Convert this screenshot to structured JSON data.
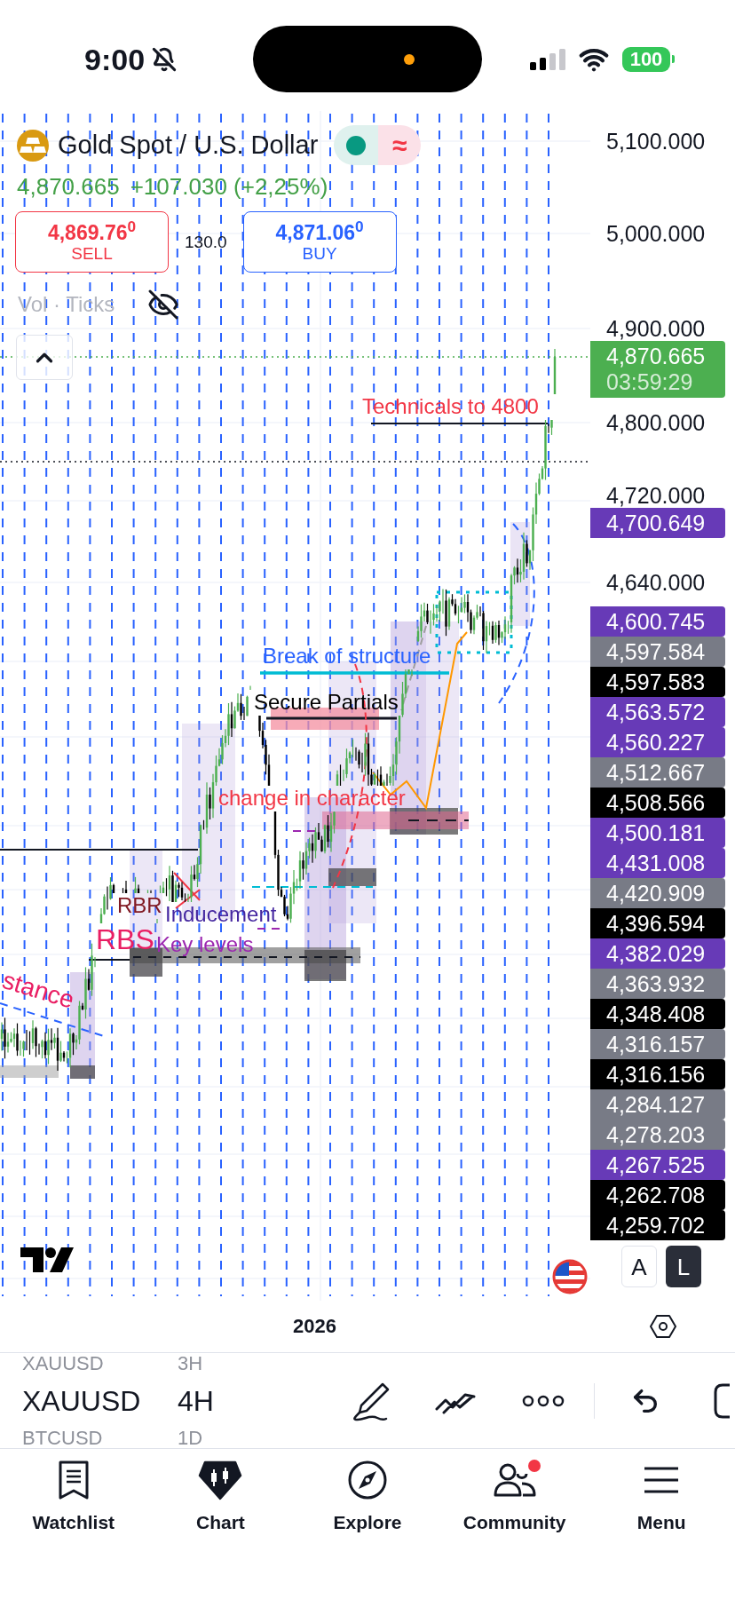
{
  "status_bar": {
    "time": "9:00",
    "battery": "100"
  },
  "header": {
    "title": "Gold Spot / U.S. Dollar",
    "delay_symbol": "≈",
    "price": "4,870.665",
    "change": "+107.030 (+2,25%)"
  },
  "trade": {
    "sell": {
      "price": "4,869.76$^{0}$",
      "label": "SELL"
    },
    "spread": "130.0",
    "buy": {
      "price": "4,871.06$^{0}$",
      "label": "BUY"
    }
  },
  "indicator": {
    "label": "Vol · Ticks",
    "visible": false
  },
  "annotations": [
    {
      "text": "Technicals to 4800",
      "color": "#f23645"
    },
    {
      "text": "Break of structure",
      "color": "#2962ff"
    },
    {
      "text": "Secure Partials",
      "color": "#000000"
    },
    {
      "text": "change in character",
      "color": "#f23645"
    },
    {
      "text": "RBR",
      "color": "#801922"
    },
    {
      "text": "Inducement",
      "color": "#4527a0"
    },
    {
      "text": "RBS",
      "color": "#e91e63"
    },
    {
      "text": "Key levels",
      "color": "#9c27b0"
    },
    {
      "text": "stance",
      "color": "#e91e63"
    }
  ],
  "price_axis": {
    "ticks": [
      "5,100.000",
      "5,000.000",
      "4,900.000",
      "4,800.000",
      "4,720.000",
      "4,640.000"
    ],
    "last_price": {
      "price": "4,870.665",
      "countdown": "03:59:29"
    },
    "labels": [
      {
        "value": "4,700.649",
        "color": "#673ab7"
      },
      {
        "value": "4,600.745",
        "color": "#673ab7"
      },
      {
        "value": "4,597.584",
        "color": "#787b86"
      },
      {
        "value": "4,597.583",
        "color": "#000000"
      },
      {
        "value": "4,563.572",
        "color": "#673ab7"
      },
      {
        "value": "4,560.227",
        "color": "#673ab7"
      },
      {
        "value": "4,512.667",
        "color": "#787b86"
      },
      {
        "value": "4,508.566",
        "color": "#000000"
      },
      {
        "value": "4,500.181",
        "color": "#673ab7"
      },
      {
        "value": "4,431.008",
        "color": "#673ab7"
      },
      {
        "value": "4,420.909",
        "color": "#787b86"
      },
      {
        "value": "4,396.594",
        "color": "#000000"
      },
      {
        "value": "4,382.029",
        "color": "#673ab7"
      },
      {
        "value": "4,363.932",
        "color": "#787b86"
      },
      {
        "value": "4,348.408",
        "color": "#000000"
      },
      {
        "value": "4,316.157",
        "color": "#787b86"
      },
      {
        "value": "4,316.156",
        "color": "#000000"
      },
      {
        "value": "4,284.127",
        "color": "#787b86"
      },
      {
        "value": "4,278.203",
        "color": "#787b86"
      },
      {
        "value": "4,267.525",
        "color": "#673ab7"
      },
      {
        "value": "4,262.708",
        "color": "#000000"
      },
      {
        "value": "4,259.702",
        "color": "#000000"
      }
    ]
  },
  "scale_buttons": [
    {
      "label": "A",
      "selected": false
    },
    {
      "label": "L",
      "selected": true
    }
  ],
  "time_axis": {
    "year": "2026"
  },
  "toolbar": {
    "symbols": [
      {
        "text": "XAUUSD",
        "selected": false
      },
      {
        "text": "XAUUSD",
        "selected": true
      },
      {
        "text": "BTCUSD",
        "selected": false
      }
    ],
    "intervals": [
      {
        "text": "3H",
        "selected": false
      },
      {
        "text": "4H",
        "selected": true
      },
      {
        "text": "1D",
        "selected": false
      }
    ]
  },
  "tab_bar": [
    {
      "label": "Watchlist",
      "selected": false,
      "notification": false
    },
    {
      "label": "Chart",
      "selected": true,
      "notification": false
    },
    {
      "label": "Explore",
      "selected": false,
      "notification": false
    },
    {
      "label": "Community",
      "selected": false,
      "notification": true
    },
    {
      "label": "Menu",
      "selected": false,
      "notification": false
    }
  ]
}
